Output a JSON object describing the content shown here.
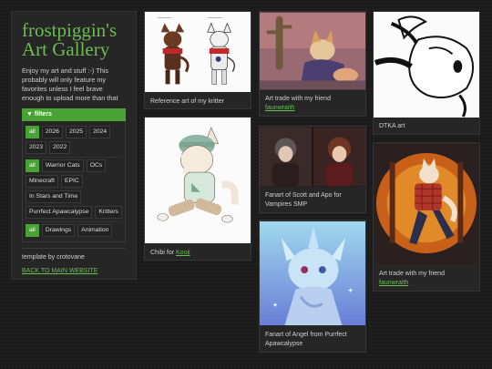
{
  "sidebar": {
    "title_line1": "frostpiggin's",
    "title_line2": "Art Gallery",
    "intro": "Enjoy my art and stuff :-) This probably will only feature my favorites unless I feel brave enough to upload more than that",
    "filters_label": "▼ filters",
    "years": [
      "all",
      "2026",
      "2025",
      "2024",
      "2023",
      "2022"
    ],
    "categories": [
      "all",
      "Warrior Cats",
      "OCs",
      "Minecraft",
      "EPIC",
      "In Stars and Time",
      "Purrfect Apawcalypse",
      "Kritters"
    ],
    "types": [
      "all",
      "Drawings",
      "Animation"
    ],
    "credits": "template by crotovane",
    "back_link": "BACK TO MAIN WEBSITE"
  },
  "gallery": [
    {
      "caption": "Reference art of my kritter",
      "link": ""
    },
    {
      "caption": "Chibi for ",
      "link": "Kooji"
    },
    {
      "caption": "Art trade with my friend",
      "link": "faunwraith"
    },
    {
      "caption": "Fanart of Scott and Apo for Vampires SMP",
      "link": ""
    },
    {
      "caption": "Fanart of Angel from Purrfect Apawcalypse",
      "link": ""
    },
    {
      "caption": "DTKA art",
      "link": ""
    },
    {
      "caption": "Art trade with my friend",
      "link": "faunwraith"
    }
  ],
  "colors": {
    "accent": "#49a334",
    "title": "#6abe4f"
  }
}
